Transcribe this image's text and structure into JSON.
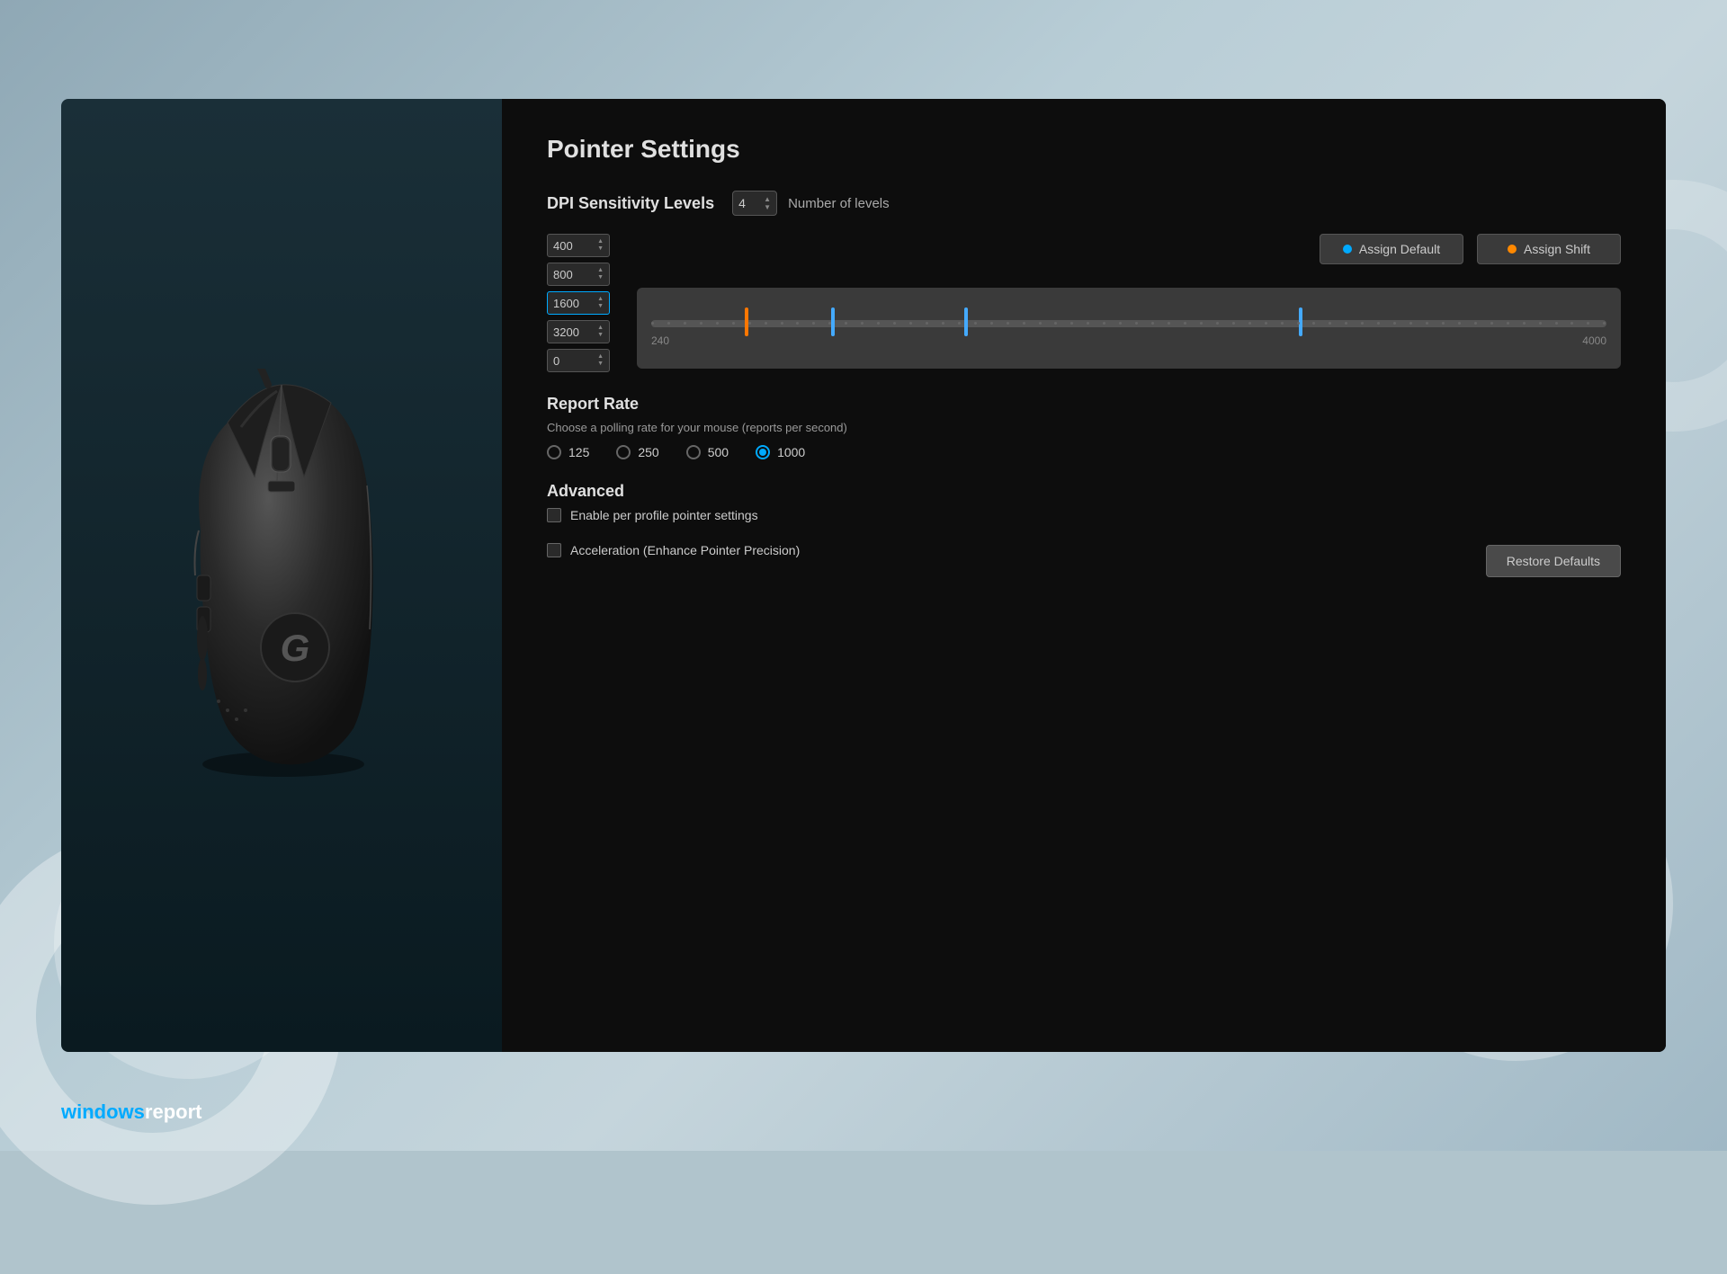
{
  "page": {
    "title": "Pointer Settings",
    "brand": {
      "prefix": "windows",
      "suffix": "report"
    }
  },
  "dpi": {
    "section_label": "DPI Sensitivity Levels",
    "number_of_levels_value": "4",
    "number_of_levels_label": "Number of levels",
    "levels": [
      {
        "value": "400"
      },
      {
        "value": "800"
      },
      {
        "value": "1600"
      },
      {
        "value": "3200"
      },
      {
        "value": "0"
      }
    ],
    "assign_default_label": "Assign Default",
    "assign_shift_label": "Assign Shift",
    "slider_min": "240",
    "slider_max": "4000",
    "markers": [
      {
        "position": 10,
        "type": "orange"
      },
      {
        "position": 20,
        "type": "blue"
      },
      {
        "position": 35,
        "type": "blue"
      },
      {
        "position": 70,
        "type": "blue"
      }
    ]
  },
  "report_rate": {
    "title": "Report Rate",
    "description": "Choose a polling rate for your mouse (reports per second)",
    "options": [
      {
        "label": "125",
        "selected": false
      },
      {
        "label": "250",
        "selected": false
      },
      {
        "label": "500",
        "selected": false
      },
      {
        "label": "1000",
        "selected": true
      }
    ]
  },
  "advanced": {
    "title": "Advanced",
    "checkboxes": [
      {
        "label": "Enable per profile pointer settings",
        "checked": false
      },
      {
        "label": "Acceleration (Enhance Pointer Precision)",
        "checked": false
      }
    ],
    "restore_button": "Restore Defaults"
  }
}
